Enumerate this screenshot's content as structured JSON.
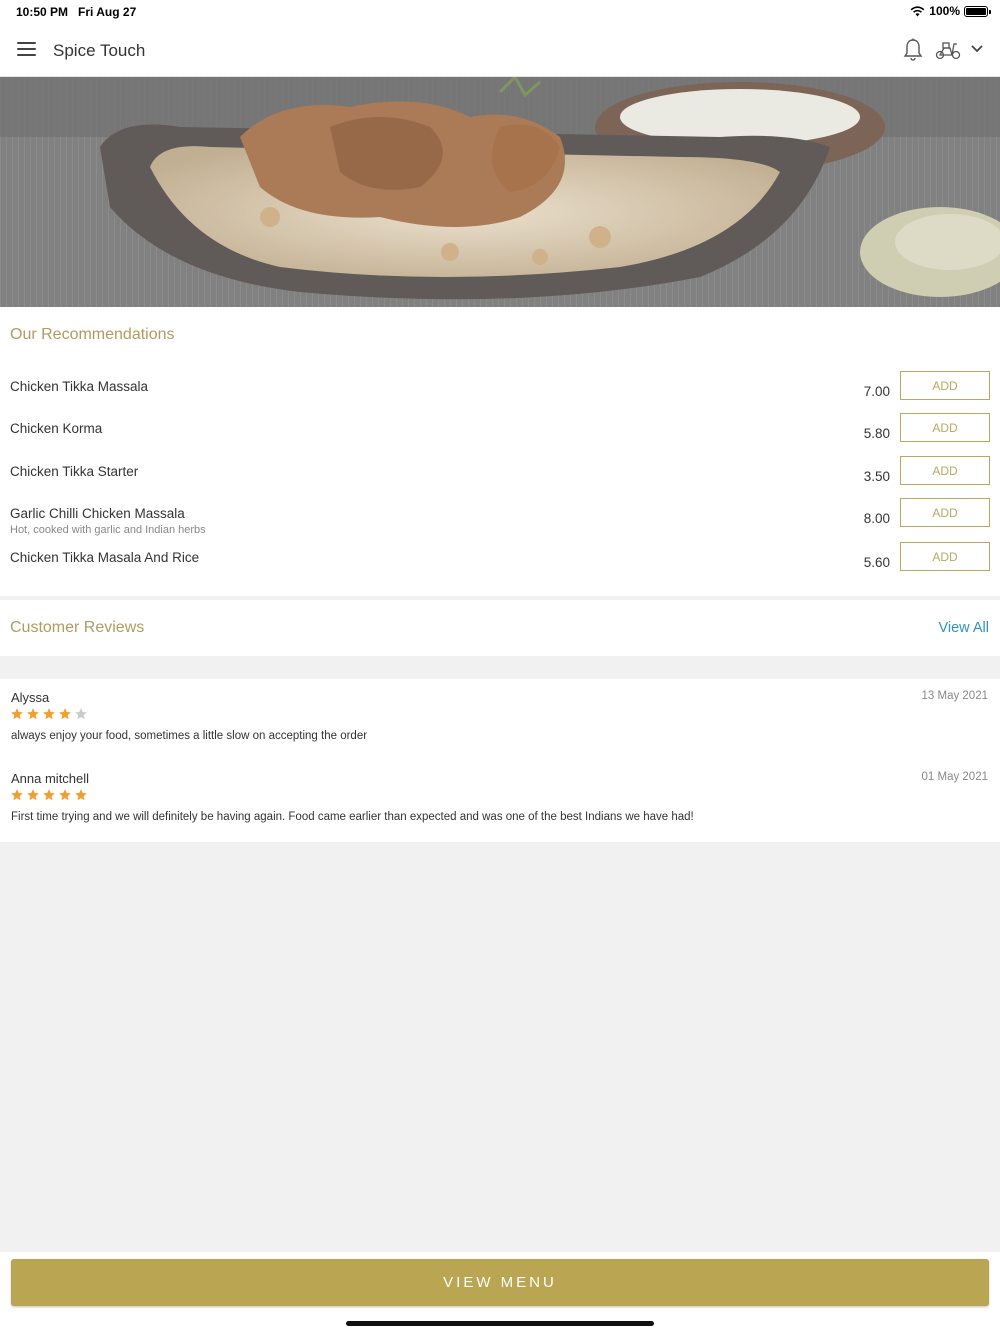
{
  "status": {
    "time": "10:50 PM",
    "date": "Fri Aug 27",
    "battery": "100%"
  },
  "header": {
    "title": "Spice Touch"
  },
  "recommendations": {
    "title": "Our Recommendations",
    "items": [
      {
        "name": "Chicken Tikka Massala",
        "desc": "",
        "price": "7.00",
        "add": "ADD"
      },
      {
        "name": "Chicken Korma",
        "desc": "",
        "price": "5.80",
        "add": "ADD"
      },
      {
        "name": "Chicken Tikka Starter",
        "desc": "",
        "price": "3.50",
        "add": "ADD"
      },
      {
        "name": "Garlic Chilli Chicken Massala",
        "desc": "Hot, cooked with garlic and Indian herbs",
        "price": "8.00",
        "add": "ADD"
      },
      {
        "name": "Chicken Tikka Masala And Rice",
        "desc": "",
        "price": "5.60",
        "add": "ADD"
      }
    ]
  },
  "reviews": {
    "title": "Customer Reviews",
    "view_all": "View All",
    "items": [
      {
        "name": "Alyssa",
        "date": "13 May 2021",
        "rating": 4,
        "text": "always enjoy your food, sometimes a little slow on accepting the order"
      },
      {
        "name": "Anna mitchell",
        "date": "01 May 2021",
        "rating": 5,
        "text": "First time trying and we will definitely be having again. Food came earlier than expected and was one of the best Indians we have had!"
      }
    ]
  },
  "footer": {
    "view_menu": "VIEW MENU"
  },
  "colors": {
    "accent": "#b9a552",
    "link": "#2f92c7",
    "star": "#f0a030",
    "star_empty": "#cccccc"
  }
}
